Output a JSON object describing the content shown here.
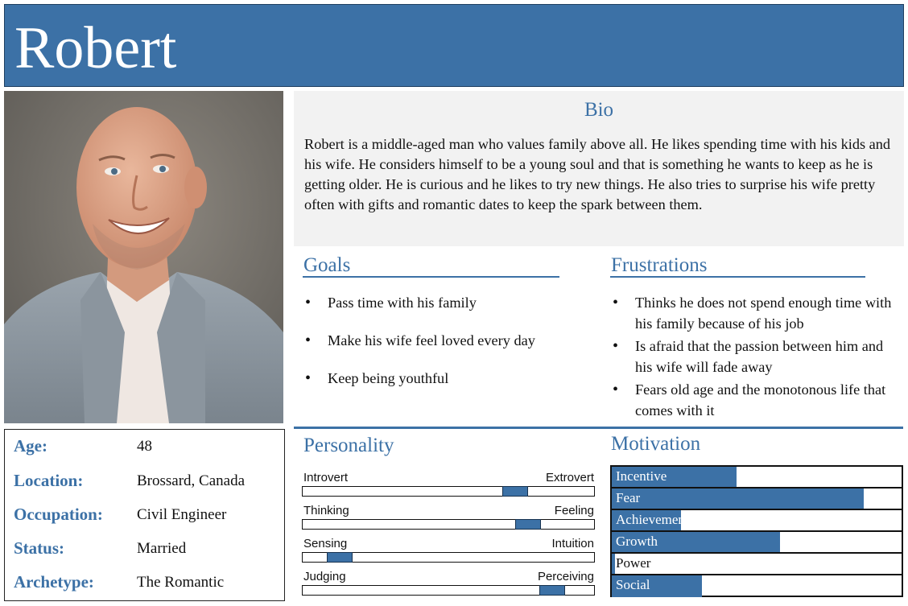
{
  "persona": {
    "name": "Robert"
  },
  "info": [
    {
      "label": "Age:",
      "value": "48"
    },
    {
      "label": "Location:",
      "value": "Brossard, Canada"
    },
    {
      "label": "Occupation:",
      "value": "Civil Engineer"
    },
    {
      "label": "Status:",
      "value": "Married"
    },
    {
      "label": "Archetype:",
      "value": "The Romantic"
    }
  ],
  "bio": {
    "title": "Bio",
    "text": "Robert is a middle-aged man who values family above all. He likes spending time with his kids and his wife. He considers himself to be a young soul and that is something he wants to keep as he is getting older. He is curious and he likes to try new things. He also tries to surprise his wife pretty often with gifts and romantic dates to keep the spark between them."
  },
  "goals": {
    "title": "Goals",
    "items": [
      "Pass time with his family",
      "Make his wife feel loved every day",
      "Keep being youthful"
    ]
  },
  "frustrations": {
    "title": "Frustrations",
    "items": [
      "Thinks he does not spend enough time with his family because of his job",
      "Is afraid that the passion between him and his wife will fade away",
      "Fears old age and the monotonous life that comes with it"
    ]
  },
  "personality": {
    "title": "Personality",
    "sliders": [
      {
        "left": "Introvert",
        "right": "Extrovert",
        "level": 0.75
      },
      {
        "left": "Thinking",
        "right": "Feeling",
        "level": 0.8
      },
      {
        "left": "Sensing",
        "right": "Intuition",
        "level": 0.09
      },
      {
        "left": "Judging",
        "right": "Perceiving",
        "level": 0.89
      }
    ]
  },
  "motivation": {
    "title": "Motivation",
    "bars": [
      {
        "label": "Incentive",
        "level": 0.43
      },
      {
        "label": "Fear",
        "level": 0.87
      },
      {
        "label": "Achievement",
        "level": 0.24
      },
      {
        "label": "Growth",
        "level": 0.58
      },
      {
        "label": "Power",
        "level": 0.01
      },
      {
        "label": "Social",
        "level": 0.31
      }
    ]
  },
  "colors": {
    "accent": "#3c71a6",
    "panel": "#f2f2f2"
  }
}
